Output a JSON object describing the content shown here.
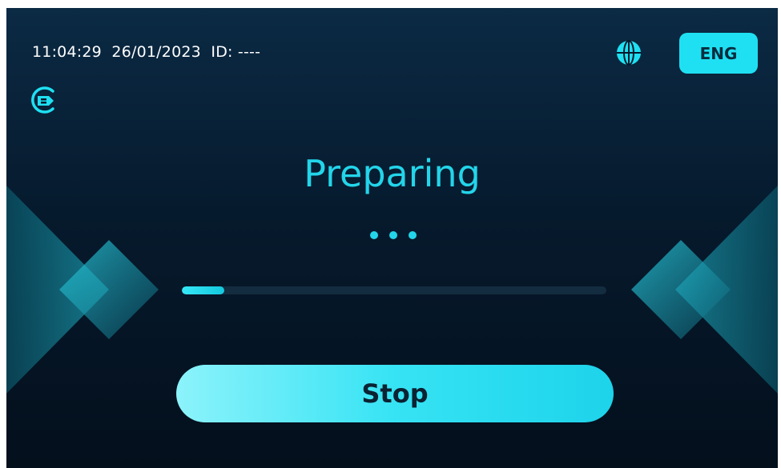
{
  "status_bar": {
    "time": "11:04:29",
    "date": "26/01/2023",
    "id_label": "ID:",
    "id_value": "----"
  },
  "language": {
    "current": "ENG"
  },
  "charger": {
    "state": "Preparing",
    "progress_percent": 10
  },
  "actions": {
    "stop_label": "Stop"
  },
  "icons": {
    "connector": "charging-connector-icon",
    "globe": "globe-icon",
    "loading": "three-dots-icon"
  },
  "colors": {
    "accent": "#1fe0f2",
    "title": "#23d5ea",
    "background_top": "#0b2a44",
    "background_bottom": "#040f1c",
    "button_text": "#0b2232"
  }
}
